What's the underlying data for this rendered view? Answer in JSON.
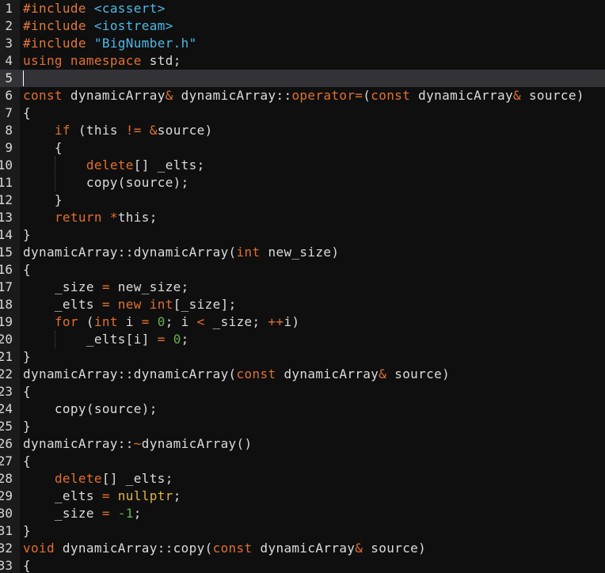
{
  "editor": {
    "current_line": 5,
    "colors": {
      "background": "#0f0f0f",
      "gutter": "#1b1b1b",
      "current_line": "#333337",
      "preprocessor": "#e07a3a",
      "include_path": "#4cb8e6",
      "keyword": "#e0702e",
      "number": "#63b34a",
      "constant": "#e0b243",
      "text": "#dcdcdc"
    },
    "lines": [
      {
        "num": "1",
        "tokens": [
          [
            "preproc",
            "#include"
          ],
          [
            "plain",
            " "
          ],
          [
            "incl",
            "<cassert>"
          ]
        ]
      },
      {
        "num": "2",
        "tokens": [
          [
            "preproc",
            "#include"
          ],
          [
            "plain",
            " "
          ],
          [
            "incl",
            "<iostream>"
          ]
        ]
      },
      {
        "num": "3",
        "tokens": [
          [
            "preproc",
            "#include"
          ],
          [
            "plain",
            " "
          ],
          [
            "incl",
            "\"BigNumber.h\""
          ]
        ]
      },
      {
        "num": "4",
        "tokens": [
          [
            "kw",
            "using"
          ],
          [
            "plain",
            " "
          ],
          [
            "kw",
            "namespace"
          ],
          [
            "plain",
            " std;"
          ]
        ]
      },
      {
        "num": "5",
        "tokens": []
      },
      {
        "num": "6",
        "tokens": [
          [
            "kw",
            "const"
          ],
          [
            "plain",
            " dynamicArray"
          ],
          [
            "op",
            "&"
          ],
          [
            "plain",
            " dynamicArray::"
          ],
          [
            "kw",
            "operator="
          ],
          [
            "plain",
            "("
          ],
          [
            "kw",
            "const"
          ],
          [
            "plain",
            " dynamicArray"
          ],
          [
            "op",
            "&"
          ],
          [
            "plain",
            " source)"
          ]
        ]
      },
      {
        "num": "7",
        "tokens": [
          [
            "plain",
            "{"
          ]
        ]
      },
      {
        "num": "8",
        "tokens": [
          [
            "plain",
            "    "
          ],
          [
            "kw",
            "if"
          ],
          [
            "plain",
            " (this "
          ],
          [
            "op",
            "!="
          ],
          [
            "plain",
            " "
          ],
          [
            "op",
            "&"
          ],
          [
            "plain",
            "source)"
          ]
        ]
      },
      {
        "num": "9",
        "tokens": [
          [
            "plain",
            "    {"
          ]
        ]
      },
      {
        "num": "10",
        "tokens": [
          [
            "plain",
            "        "
          ],
          [
            "kw",
            "delete"
          ],
          [
            "plain",
            "[] _elts;"
          ]
        ]
      },
      {
        "num": "11",
        "tokens": [
          [
            "plain",
            "        copy(source);"
          ]
        ]
      },
      {
        "num": "12",
        "tokens": [
          [
            "plain",
            "    }"
          ]
        ]
      },
      {
        "num": "13",
        "tokens": [
          [
            "plain",
            "    "
          ],
          [
            "kw",
            "return"
          ],
          [
            "plain",
            " "
          ],
          [
            "op",
            "*"
          ],
          [
            "plain",
            "this;"
          ]
        ]
      },
      {
        "num": "14",
        "tokens": [
          [
            "plain",
            "}"
          ]
        ]
      },
      {
        "num": "15",
        "tokens": [
          [
            "plain",
            "dynamicArray::dynamicArray("
          ],
          [
            "kw",
            "int"
          ],
          [
            "plain",
            " new_size)"
          ]
        ]
      },
      {
        "num": "16",
        "tokens": [
          [
            "plain",
            "{"
          ]
        ]
      },
      {
        "num": "17",
        "tokens": [
          [
            "plain",
            "    _size "
          ],
          [
            "op",
            "="
          ],
          [
            "plain",
            " new_size;"
          ]
        ]
      },
      {
        "num": "18",
        "tokens": [
          [
            "plain",
            "    _elts "
          ],
          [
            "op",
            "="
          ],
          [
            "plain",
            " "
          ],
          [
            "kw",
            "new"
          ],
          [
            "plain",
            " "
          ],
          [
            "kw",
            "int"
          ],
          [
            "plain",
            "[_size];"
          ]
        ]
      },
      {
        "num": "19",
        "tokens": [
          [
            "plain",
            "    "
          ],
          [
            "kw",
            "for"
          ],
          [
            "plain",
            " ("
          ],
          [
            "kw",
            "int"
          ],
          [
            "plain",
            " i "
          ],
          [
            "op",
            "="
          ],
          [
            "plain",
            " "
          ],
          [
            "num",
            "0"
          ],
          [
            "plain",
            "; i "
          ],
          [
            "op",
            "<"
          ],
          [
            "plain",
            " _size; "
          ],
          [
            "op",
            "++"
          ],
          [
            "plain",
            "i)"
          ]
        ]
      },
      {
        "num": "20",
        "tokens": [
          [
            "plain",
            "        _elts[i] "
          ],
          [
            "op",
            "="
          ],
          [
            "plain",
            " "
          ],
          [
            "num",
            "0"
          ],
          [
            "plain",
            ";"
          ]
        ]
      },
      {
        "num": "21",
        "tokens": [
          [
            "plain",
            "}"
          ]
        ]
      },
      {
        "num": "22",
        "tokens": [
          [
            "plain",
            "dynamicArray::dynamicArray("
          ],
          [
            "kw",
            "const"
          ],
          [
            "plain",
            " dynamicArray"
          ],
          [
            "op",
            "&"
          ],
          [
            "plain",
            " source)"
          ]
        ]
      },
      {
        "num": "23",
        "tokens": [
          [
            "plain",
            "{"
          ]
        ]
      },
      {
        "num": "24",
        "tokens": [
          [
            "plain",
            "    copy(source);"
          ]
        ]
      },
      {
        "num": "25",
        "tokens": [
          [
            "plain",
            "}"
          ]
        ]
      },
      {
        "num": "26",
        "tokens": [
          [
            "plain",
            "dynamicArray::"
          ],
          [
            "op",
            "~"
          ],
          [
            "plain",
            "dynamicArray()"
          ]
        ]
      },
      {
        "num": "27",
        "tokens": [
          [
            "plain",
            "{"
          ]
        ]
      },
      {
        "num": "28",
        "tokens": [
          [
            "plain",
            "    "
          ],
          [
            "kw",
            "delete"
          ],
          [
            "plain",
            "[] _elts;"
          ]
        ]
      },
      {
        "num": "29",
        "tokens": [
          [
            "plain",
            "    _elts "
          ],
          [
            "op",
            "="
          ],
          [
            "plain",
            " "
          ],
          [
            "const",
            "nullptr"
          ],
          [
            "plain",
            ";"
          ]
        ]
      },
      {
        "num": "30",
        "tokens": [
          [
            "plain",
            "    _size "
          ],
          [
            "op",
            "="
          ],
          [
            "plain",
            " "
          ],
          [
            "num",
            "-1"
          ],
          [
            "plain",
            ";"
          ]
        ]
      },
      {
        "num": "31",
        "tokens": [
          [
            "plain",
            "}"
          ]
        ]
      },
      {
        "num": "32",
        "tokens": [
          [
            "kw",
            "void"
          ],
          [
            "plain",
            " dynamicArray::copy("
          ],
          [
            "kw",
            "const"
          ],
          [
            "plain",
            " dynamicArray"
          ],
          [
            "op",
            "&"
          ],
          [
            "plain",
            " source)"
          ]
        ]
      },
      {
        "num": "33",
        "tokens": [
          [
            "plain",
            "{"
          ]
        ]
      }
    ]
  }
}
